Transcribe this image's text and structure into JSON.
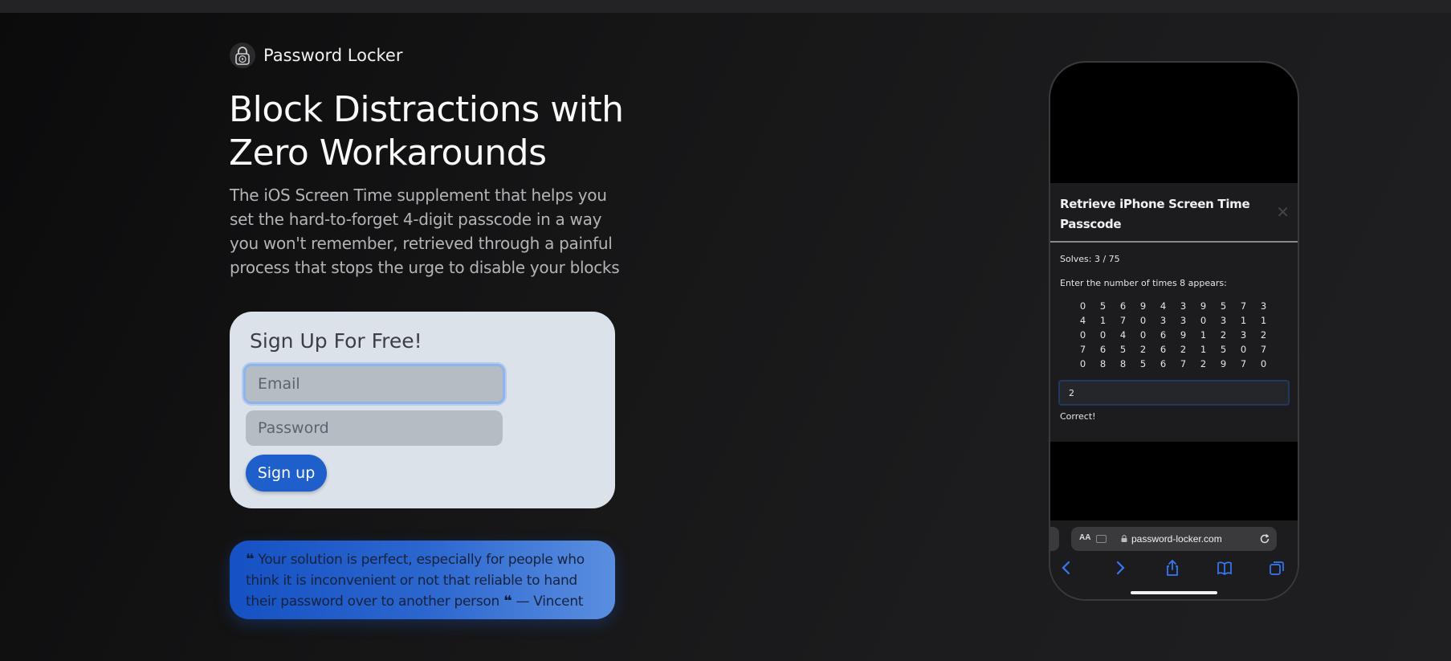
{
  "brand": {
    "name": "Password Locker",
    "logo_icon": "padlock-icon"
  },
  "hero": {
    "headline": "Block Distractions with Zero Workarounds",
    "subheadline": "The iOS Screen Time supplement that helps you set the hard-to-forget 4-digit passcode in a way you won't remember, retrieved through a painful process that stops the urge to disable your blocks"
  },
  "signup": {
    "title": "Sign Up For Free!",
    "email_placeholder": "Email",
    "password_placeholder": "Password",
    "button_label": "Sign up"
  },
  "testimonial": {
    "quote": "Your solution is perfect, especially for people who think it is inconvenient or not that reliable to hand their password over to another person",
    "author": "— Vincent"
  },
  "phone": {
    "dialog": {
      "title": "Retrieve iPhone Screen Time Passcode",
      "close_icon": "close-icon",
      "solves": "Solves: 3 / 75",
      "instruction": "Enter the number of times 8 appears:",
      "grid": [
        [
          "0",
          "5",
          "6",
          "9",
          "4",
          "3",
          "9",
          "5",
          "7",
          "3"
        ],
        [
          "4",
          "1",
          "7",
          "0",
          "3",
          "3",
          "0",
          "3",
          "1",
          "1"
        ],
        [
          "0",
          "0",
          "4",
          "0",
          "6",
          "9",
          "1",
          "2",
          "3",
          "2"
        ],
        [
          "7",
          "6",
          "5",
          "2",
          "6",
          "2",
          "1",
          "5",
          "0",
          "7"
        ],
        [
          "0",
          "8",
          "8",
          "5",
          "6",
          "7",
          "2",
          "9",
          "7",
          "0"
        ]
      ],
      "answer_value": "2",
      "feedback": "Correct!"
    },
    "browser": {
      "text_size_label": "AA",
      "url": "password-locker.com",
      "toolbar_icons": [
        "back-icon",
        "forward-icon",
        "share-icon",
        "bookmarks-icon",
        "tabs-icon"
      ]
    }
  },
  "colors": {
    "accent": "#1f5fcc",
    "card_background": "#dce2ea",
    "safari_blue": "#3478f6"
  }
}
